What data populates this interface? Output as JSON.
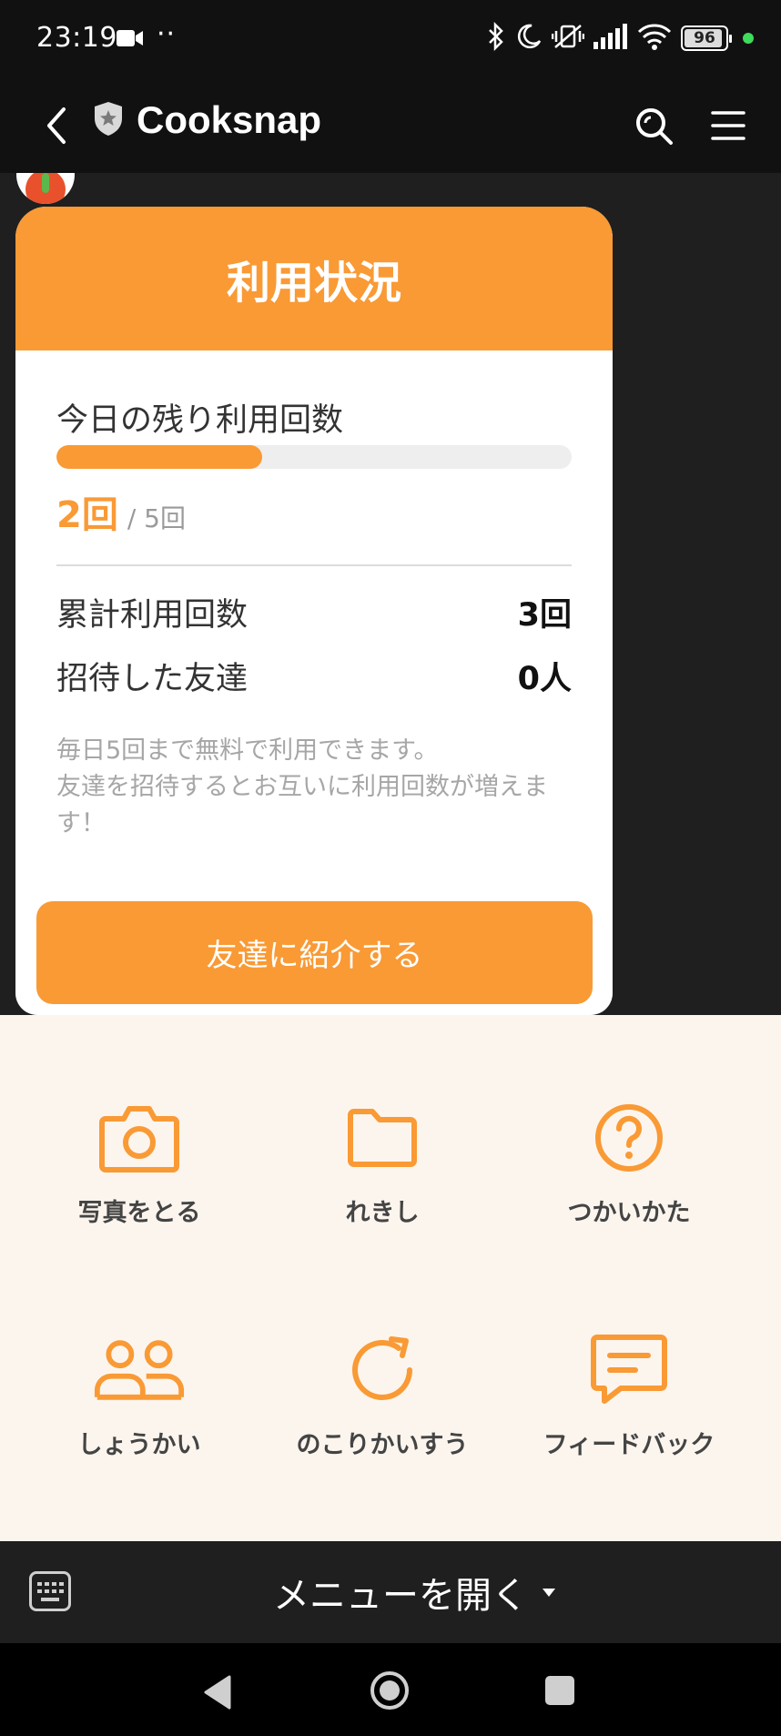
{
  "status_bar": {
    "time": "23:19",
    "dots": "··",
    "battery": "96",
    "icons": [
      "video-icon",
      "bluetooth-icon",
      "moon-icon",
      "vibrate-off-icon",
      "signal-icon",
      "wifi-icon",
      "battery-icon"
    ]
  },
  "header": {
    "title": "Cooksnap"
  },
  "card": {
    "title": "利用状況",
    "remaining_label": "今日の残り利用回数",
    "progress_fraction": 0.4,
    "current_count": "2回",
    "total_count": "/ 5回",
    "stats": [
      {
        "label": "累計利用回数",
        "value": "3回"
      },
      {
        "label": "招待した友達",
        "value": "0人"
      }
    ],
    "note": "毎日5回まで無料で利用できます。\n友達を招待するとお互いに利用回数が増えま す！",
    "cta_label": "友達に紹介する"
  },
  "rich_menu": {
    "accent": "#f99a35",
    "items": [
      {
        "label": "写真をとる",
        "icon": "camera-icon"
      },
      {
        "label": "れきし",
        "icon": "folder-icon"
      },
      {
        "label": "つかいかた",
        "icon": "help-icon"
      },
      {
        "label": "しょうかい",
        "icon": "people-icon"
      },
      {
        "label": "のこりかいすう",
        "icon": "refresh-icon"
      },
      {
        "label": "フィードバック",
        "icon": "chat-bubble-icon"
      }
    ]
  },
  "bottom_bar": {
    "menu_label": "メニューを開く"
  }
}
